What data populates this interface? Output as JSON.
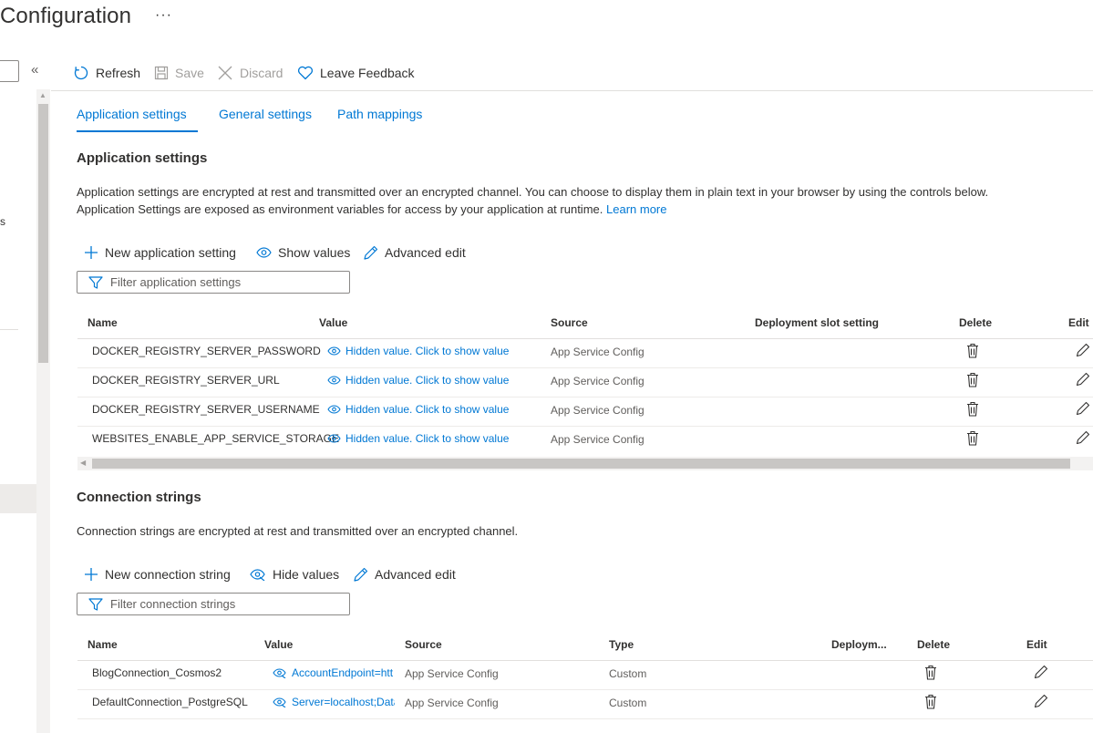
{
  "page": {
    "title": "Configuration",
    "more": "···"
  },
  "toolbar": {
    "refresh": "Refresh",
    "save": "Save",
    "discard": "Discard",
    "feedback": "Leave Feedback"
  },
  "left": {
    "collapse": "«",
    "cut_text": "s"
  },
  "tabs": [
    {
      "label": "Application settings",
      "selected": true
    },
    {
      "label": "General settings",
      "selected": false
    },
    {
      "label": "Path mappings",
      "selected": false
    }
  ],
  "app_settings": {
    "heading": "Application settings",
    "desc_line1": "Application settings are encrypted at rest and transmitted over an encrypted channel. You can choose to display them in plain text in your browser by using the controls below.",
    "desc_line2": "Application Settings are exposed as environment variables for access by your application at runtime.",
    "learn_more": "Learn more",
    "new_label": "New application setting",
    "show_label": "Show values",
    "advanced_label": "Advanced edit",
    "filter_placeholder": "Filter application settings",
    "columns": [
      "Name",
      "Value",
      "Source",
      "Deployment slot setting",
      "Delete",
      "Edit"
    ],
    "rows": [
      {
        "name": "DOCKER_REGISTRY_SERVER_PASSWORD",
        "value": "Hidden value. Click to show value",
        "source": "App Service Config"
      },
      {
        "name": "DOCKER_REGISTRY_SERVER_URL",
        "value": "Hidden value. Click to show value",
        "source": "App Service Config"
      },
      {
        "name": "DOCKER_REGISTRY_SERVER_USERNAME",
        "value": "Hidden value. Click to show value",
        "source": "App Service Config"
      },
      {
        "name": "WEBSITES_ENABLE_APP_SERVICE_STORAGE",
        "value": "Hidden value. Click to show value",
        "source": "App Service Config"
      }
    ]
  },
  "conn_strings": {
    "heading": "Connection strings",
    "desc": "Connection strings are encrypted at rest and transmitted over an encrypted channel.",
    "new_label": "New connection string",
    "hide_label": "Hide values",
    "advanced_label": "Advanced edit",
    "filter_placeholder": "Filter connection strings",
    "columns": [
      "Name",
      "Value",
      "Source",
      "Type",
      "Deploym...",
      "Delete",
      "Edit"
    ],
    "rows": [
      {
        "name": "BlogConnection_Cosmos2",
        "value": "AccountEndpoint=htt",
        "source": "App Service Config",
        "type": "Custom"
      },
      {
        "name": "DefaultConnection_PostgreSQL",
        "value": "Server=localhost;Data",
        "source": "App Service Config",
        "type": "Custom"
      }
    ]
  },
  "colors": {
    "accent": "#0078d4",
    "disabled": "#a19f9d",
    "text": "#323130"
  }
}
